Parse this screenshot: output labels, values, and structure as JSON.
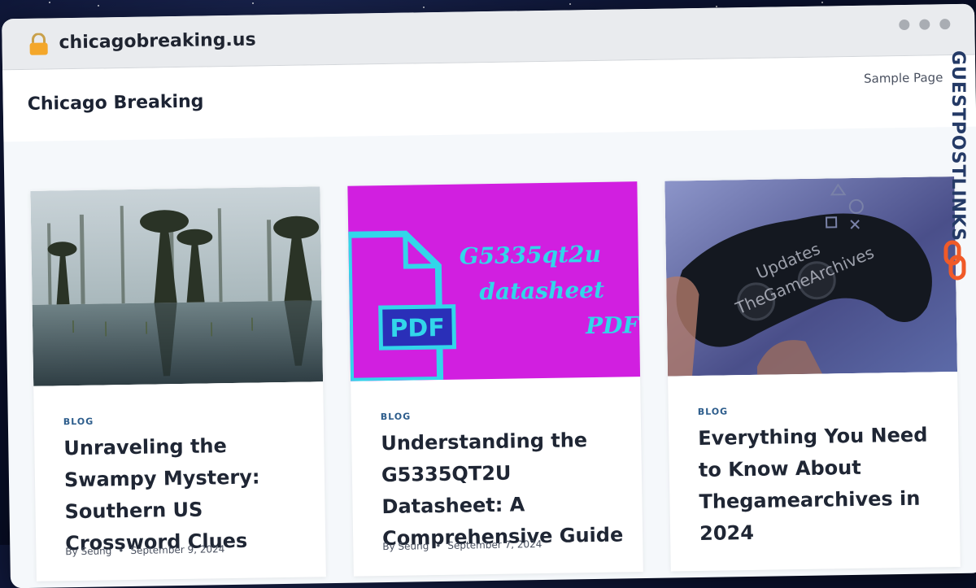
{
  "browser": {
    "url": "chicagobreaking.us"
  },
  "site": {
    "title": "Chicago Breaking",
    "nav": [
      "Sample Page"
    ]
  },
  "watermark": {
    "text": "GUESTPOSTLINKS"
  },
  "posts": [
    {
      "category": "BLOG",
      "title": "Unraveling the Swampy Mystery: Southern US Crossword Clues",
      "author": "By Seung",
      "date": "September 9, 2024"
    },
    {
      "category": "BLOG",
      "title": "Understanding the G5335QT2U Datasheet: A Comprehensive Guide",
      "author": "By Seung",
      "date": "September 7, 2024",
      "thumb_text": {
        "line1": "G5335qt2u",
        "line2": "datasheet",
        "line3": "PDF",
        "badge": "PDF"
      }
    },
    {
      "category": "BLOG",
      "title": "Everything You Need to Know About Thegamearchives in 2024",
      "thumb_text": {
        "line1": "Updates",
        "line2": "TheGameArchives"
      }
    }
  ],
  "colors": {
    "accent": "#2d5d8c",
    "thumb2_bg": "#d11fe0",
    "thumb2_text": "#32d6ea"
  }
}
